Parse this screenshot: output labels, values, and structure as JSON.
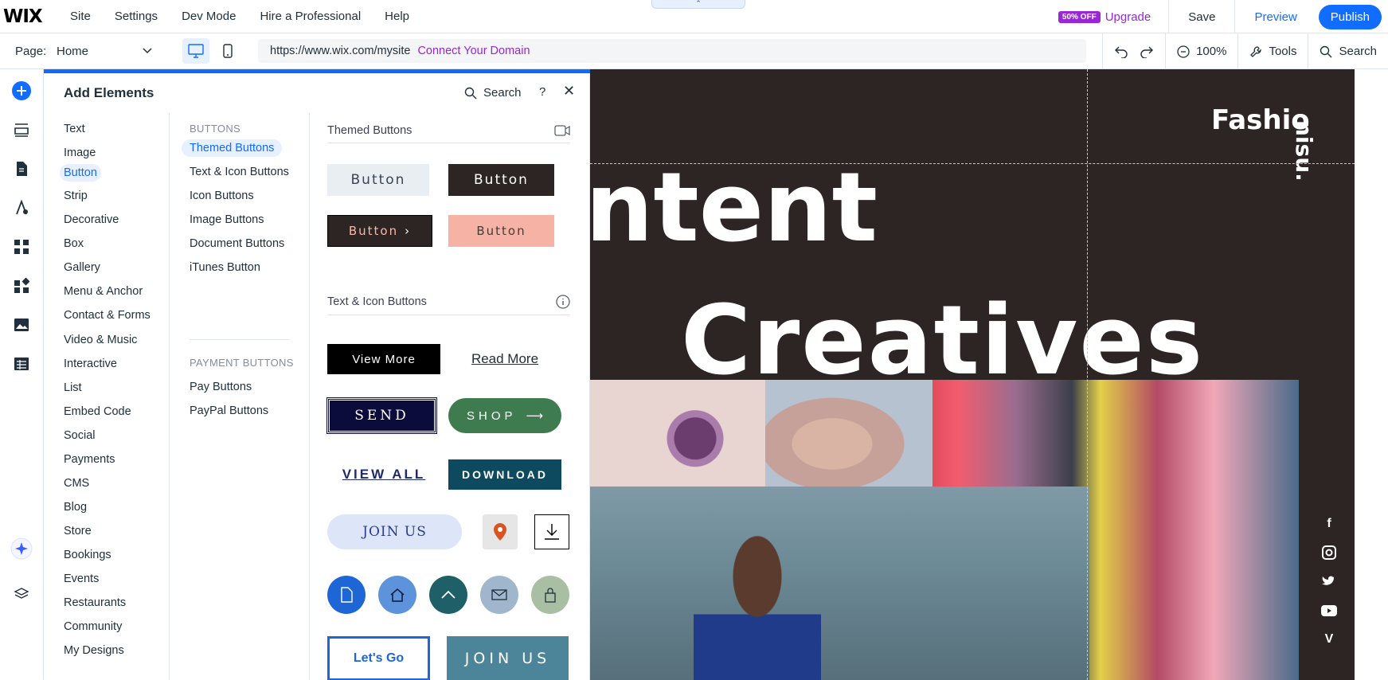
{
  "topbar": {
    "logo": "WIX",
    "menu": [
      "Site",
      "Settings",
      "Dev Mode",
      "Hire a Professional",
      "Help"
    ],
    "badge": "50% OFF",
    "upgrade": "Upgrade",
    "save": "Save",
    "preview": "Preview",
    "publish": "Publish"
  },
  "secbar": {
    "page_label": "Page:",
    "page_value": "Home",
    "url": "https://www.wix.com/mysite",
    "connect": "Connect Your Domain",
    "zoom": "100%",
    "tools": "Tools",
    "search": "Search"
  },
  "panel": {
    "title": "Add Elements",
    "search": "Search",
    "help": "?",
    "categories": [
      "Text",
      "Image",
      "Button",
      "Strip",
      "Decorative",
      "Box",
      "Gallery",
      "Menu & Anchor",
      "Contact & Forms",
      "Video & Music",
      "Interactive",
      "List",
      "Embed Code",
      "Social",
      "Payments",
      "CMS",
      "Blog",
      "Store",
      "Bookings",
      "Events",
      "Restaurants",
      "Community",
      "My Designs"
    ],
    "selected_category": "Button",
    "sub_heading_buttons": "BUTTONS",
    "sub_items_buttons": [
      "Themed Buttons",
      "Text & Icon Buttons",
      "Icon Buttons",
      "Image Buttons",
      "Document Buttons",
      "iTunes Button"
    ],
    "sub_heading_payment": "PAYMENT BUTTONS",
    "sub_items_payment": [
      "Pay Buttons",
      "PayPal Buttons"
    ],
    "section_themed": "Themed Buttons",
    "section_text_icon": "Text & Icon Buttons",
    "themed_buttons": [
      "Button",
      "Button",
      "Button",
      "Button"
    ],
    "text_icon_buttons": [
      "View More",
      "Read More",
      "SEND",
      "SHOP",
      "VIEW ALL",
      "DOWNLOAD",
      "JOIN US",
      "Let's Go",
      "JOIN US"
    ]
  },
  "canvas": {
    "text_fashion": "Fashio",
    "text_vertical": "nisu.",
    "text_content": "ntent",
    "text_creatives": "Creatives",
    "social": [
      "facebook-icon",
      "instagram-icon",
      "twitter-icon",
      "youtube-icon",
      "vimeo-icon"
    ]
  }
}
